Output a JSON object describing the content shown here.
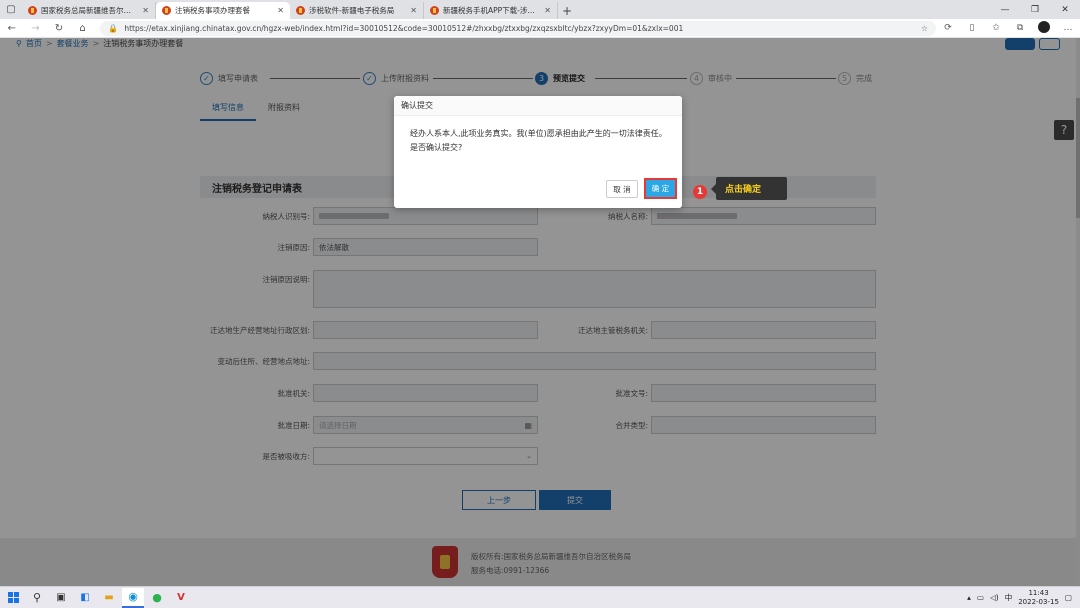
{
  "browser": {
    "tabs": [
      {
        "title": "国家税务总局新疆维吾尔自治区",
        "active": false
      },
      {
        "title": "注销税务事项办理套餐",
        "active": true
      },
      {
        "title": "涉税软件-新疆电子税务局",
        "active": false
      },
      {
        "title": "新疆税务手机APP下载-涉税软件",
        "active": false
      }
    ],
    "url": "https://etax.xinjiang.chinatax.gov.cn/hgzx-web/index.html?id=30010512&code=30010512#/zhxxbg/ztxxbg/zxqzsxbltc/ybzx?zxyyDm=01&zxlx=001"
  },
  "breadcrumb": [
    "首页",
    "套餐业务",
    "注销税务事项办理套餐"
  ],
  "steps": [
    {
      "num": "✓",
      "label": "填写申请表",
      "state": "done"
    },
    {
      "num": "✓",
      "label": "上传附报资料",
      "state": "done"
    },
    {
      "num": "3",
      "label": "预览提交",
      "state": "current"
    },
    {
      "num": "4",
      "label": "审核中",
      "state": "todo"
    },
    {
      "num": "5",
      "label": "完成",
      "state": "todo"
    }
  ],
  "subtabs": [
    "填写信息",
    "附报资料"
  ],
  "form": {
    "section_title": "注销税务登记申请表",
    "taxpayer_id_label": "纳税人识别号:",
    "taxpayer_name_label": "纳税人名称:",
    "reason_label": "注销原因:",
    "reason_value": "依法解散",
    "reason_desc_label": "注销原因说明:",
    "move_region_label": "迁达地生产经营地址行政区划:",
    "move_tax_org_label": "迁达地主管税务机关:",
    "new_address_label": "变动后住所、经营地点地址:",
    "approval_org_label": "批准机关:",
    "approval_doc_label": "批准文号:",
    "approval_date_label": "批准日期:",
    "approval_date_placeholder": "请选择日期",
    "merge_type_label": "合并类型:",
    "liquidation_label": "是否被吸收方:"
  },
  "buttons": {
    "prev": "上一步",
    "submit": "提交"
  },
  "footer": {
    "copyright": "版权所有:国家税务总局新疆维吾尔自治区税务局",
    "phone": "服务电话:0991-12366"
  },
  "dialog": {
    "title": "确认提交",
    "body": "经办人系本人,此项业务真实。我(单位)愿承担由此产生的一切法律责任。是否确认提交?",
    "cancel": "取 消",
    "ok": "确 定"
  },
  "annotation": {
    "number": "1",
    "tip": "点击确定"
  },
  "taskbar": {
    "time": "11:43",
    "date": "2022-03-15",
    "ime": "中"
  },
  "colors": {
    "primary": "#1f6fb7",
    "ok_button": "#2aa7e4",
    "highlight": "#e53935",
    "tip_text": "#f7d01c"
  }
}
